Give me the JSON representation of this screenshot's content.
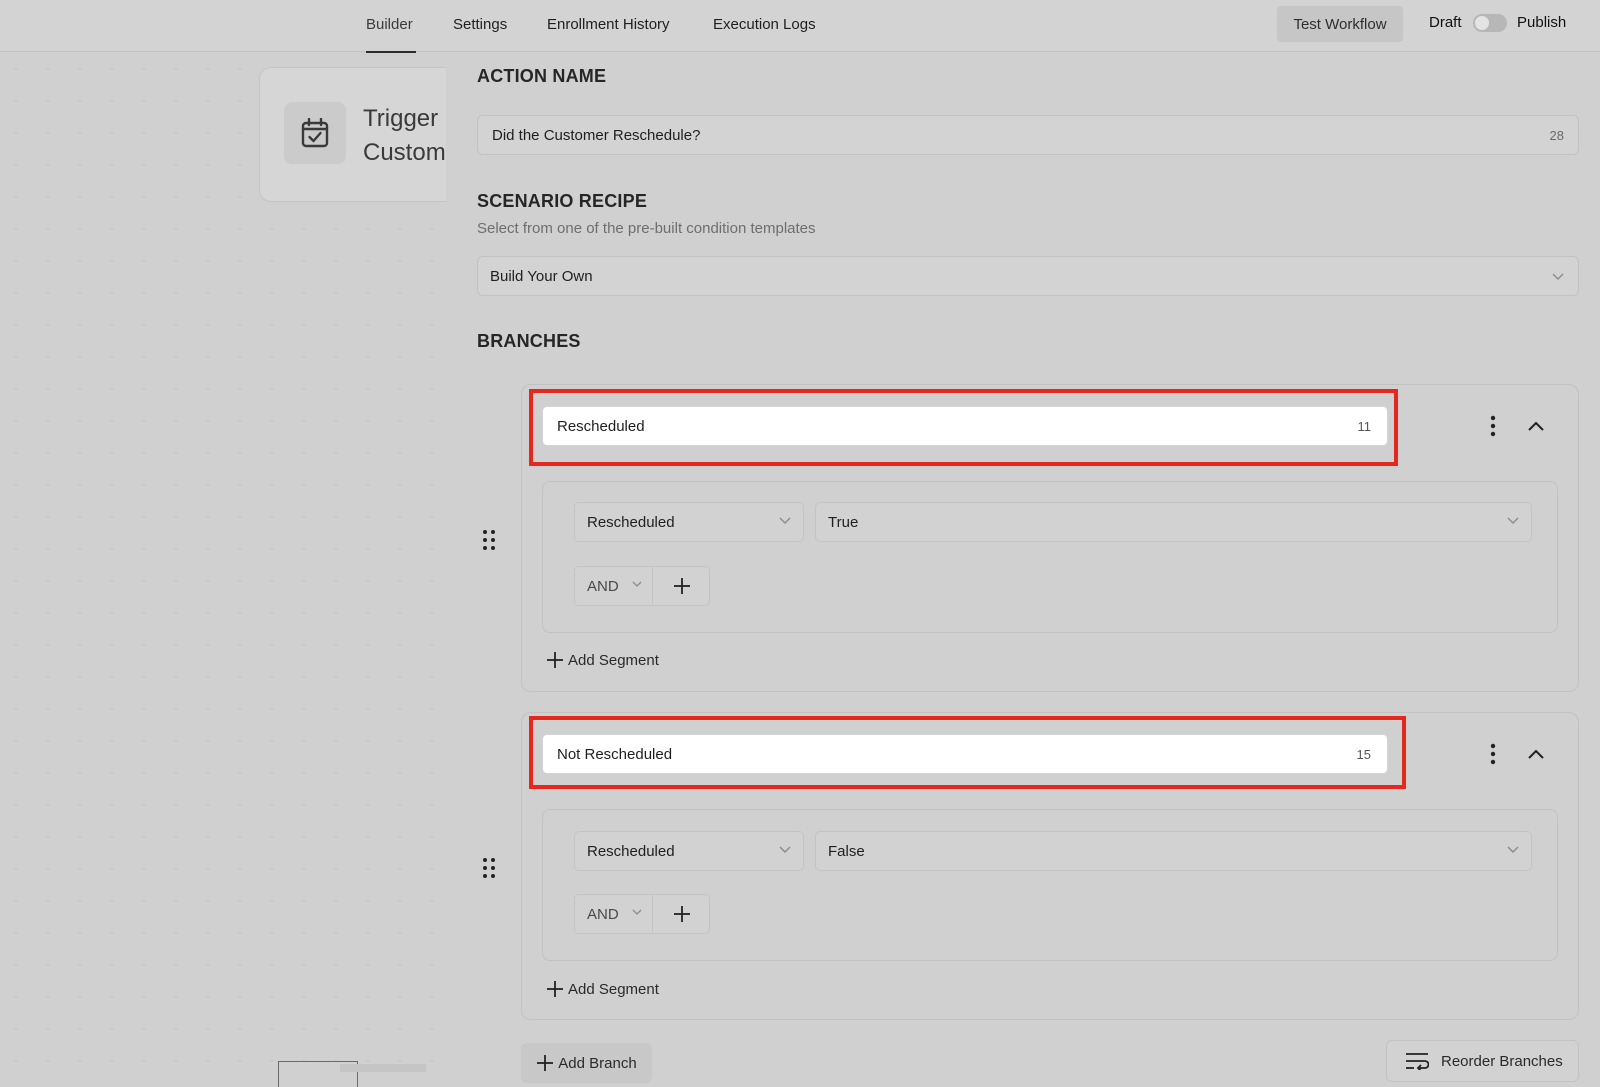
{
  "nav": {
    "tabs": [
      {
        "label": "Builder"
      },
      {
        "label": "Settings"
      },
      {
        "label": "Enrollment History"
      },
      {
        "label": "Execution Logs"
      }
    ],
    "active_tab": "Builder",
    "test_workflow_label": "Test Workflow",
    "draft_label": "Draft",
    "publish_label": "Publish",
    "published": false
  },
  "canvas": {
    "trigger_card": {
      "line1": "Trigger",
      "line2": "Custom",
      "icon": "calendar-check-icon"
    }
  },
  "panel": {
    "action_name": {
      "heading": "ACTION NAME",
      "value": "Did the Customer Reschedule?",
      "count": "28"
    },
    "scenario_recipe": {
      "heading": "SCENARIO RECIPE",
      "subtitle": "Select from one of the pre-built condition templates",
      "value": "Build Your Own"
    },
    "branches_heading": "BRANCHES",
    "branches": [
      {
        "name": "Rescheduled",
        "count": "11",
        "field": "Rescheduled",
        "operator_value": "True",
        "logic": "AND",
        "add_segment": "Add Segment"
      },
      {
        "name": "Not Rescheduled",
        "count": "15",
        "field": "Rescheduled",
        "operator_value": "False",
        "logic": "AND",
        "add_segment": "Add Segment"
      }
    ],
    "add_branch_label": "Add Branch",
    "reorder_label": "Reorder Branches"
  },
  "colors": {
    "highlight": "#e5271d"
  }
}
